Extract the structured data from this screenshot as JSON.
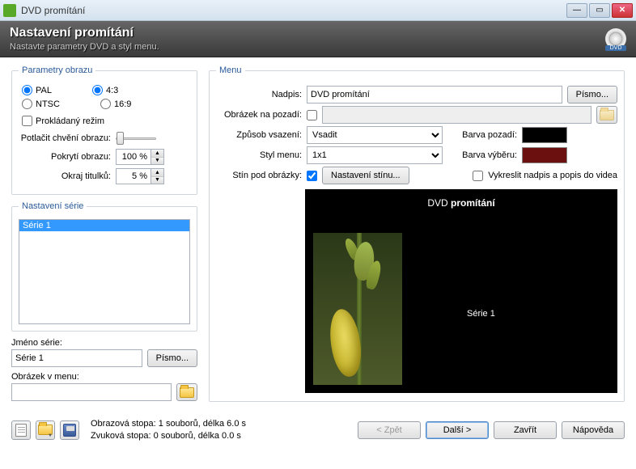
{
  "window": {
    "title": "DVD promítání"
  },
  "header": {
    "title": "Nastavení promítání",
    "subtitle": "Nastavte parametry DVD a styl menu."
  },
  "groups": {
    "image_params": "Parametry obrazu",
    "series_settings": "Nastavení série",
    "menu": "Menu"
  },
  "radios": {
    "pal": "PAL",
    "ntsc": "NTSC",
    "aspect43": "4:3",
    "aspect169": "16:9"
  },
  "checks": {
    "interlaced": "Prokládaný režim",
    "shadow_under_images": true,
    "draw_caption_into_video": "Vykreslit nadpis a popis do videa"
  },
  "labels": {
    "suppress_shake": "Potlačit chvění obrazu:",
    "coverage": "Pokrytí obrazu:",
    "subtitle_margin": "Okraj titulků:",
    "series_name": "Jméno série:",
    "menu_image": "Obrázek v menu:",
    "caption": "Nadpis:",
    "bg_image": "Obrázek na pozadí:",
    "fit_method": "Způsob vsazení:",
    "menu_style": "Styl menu:",
    "shadow": "Stín pod obrázky:",
    "bg_color": "Barva pozadí:",
    "sel_color": "Barva výběru:"
  },
  "values": {
    "coverage": "100 %",
    "subtitle_margin": "5 %",
    "series_list": [
      "Série 1"
    ],
    "series_name": "Série 1",
    "menu_image": "",
    "caption": "DVD promítání",
    "bg_image": "",
    "fit_method": "Vsadit",
    "menu_style": "1x1",
    "bg_color": "#000000",
    "sel_color": "#6b0f0f"
  },
  "buttons": {
    "font": "Písmo...",
    "shadow_settings": "Nastavení stínu...",
    "back": "< Zpět",
    "next": "Další >",
    "close": "Zavřít",
    "help": "Nápověda"
  },
  "preview": {
    "title_prefix": "DVD ",
    "title_bold": "promítání",
    "series_label": "Série 1"
  },
  "status": {
    "video": "Obrazová stopa: 1 souborů, délka 6.0 s",
    "audio": "Zvuková stopa: 0 souborů, délka 0.0 s"
  }
}
